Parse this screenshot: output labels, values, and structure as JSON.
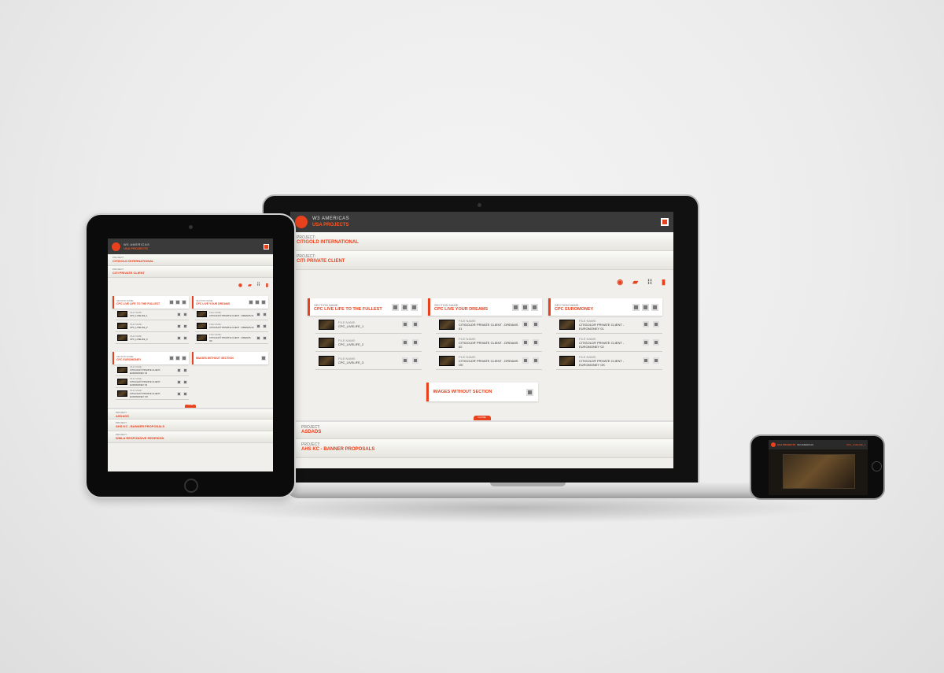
{
  "app": {
    "brand_sub": "W3 AMERICAS",
    "brand_main": "USA PROJECTS"
  },
  "accent": "#e8411e",
  "projects_top": [
    {
      "label": "PROJECT:",
      "name": "CITIGOLD INTERNATIONAL"
    },
    {
      "label": "PROJECT:",
      "name": "CITI PRIVATE CLIENT"
    }
  ],
  "toolbar": {
    "icons": [
      "eye-icon",
      "folder-icon",
      "grid-icon",
      "trash-icon"
    ]
  },
  "section_label": "SECTION NAME:",
  "file_label": "FILE NAME:",
  "sections": [
    {
      "name": "CPC LIVE LIFE TO THE FULLEST",
      "files": [
        "CPC_LIVELIFE_1",
        "CPC_LIVELIFE_2",
        "CPC_LIVELIFE_3"
      ]
    },
    {
      "name": "CPC LIVE YOUR DREAMS",
      "files": [
        "CITIGOLD® PRIVATE CLIENT - DREAMS 01",
        "CITIGOLD® PRIVATE CLIENT - DREAMS 02",
        "CITIGOLD® PRIVATE CLIENT - DREAMS OK"
      ]
    },
    {
      "name": "CPC EUROMONEY",
      "files": [
        "CITIGOLD® PRIVATE CLIENT - EUROMONEY 01",
        "CITIGOLD® PRIVATE CLIENT - EUROMONEY 02",
        "CITIGOLD® PRIVATE CLIENT - EUROMONEY OK"
      ]
    }
  ],
  "images_without_section": "IMAGES WITHOUT SECTION",
  "close_tab": "CLOSE",
  "projects_bottom": [
    {
      "label": "PROJECT:",
      "name": "ASDADS"
    },
    {
      "label": "PROJECT:",
      "name": "AHS KC - BANNER PROPOSALS"
    },
    {
      "label": "PROJECT:",
      "name": "WMLA RESPONSIVE REDESIGN"
    }
  ],
  "phone": {
    "brand_main": "USA PROJECTS",
    "brand_sub": "W3 AMERICAS",
    "file": "CPC_LIVELIFE_1"
  }
}
